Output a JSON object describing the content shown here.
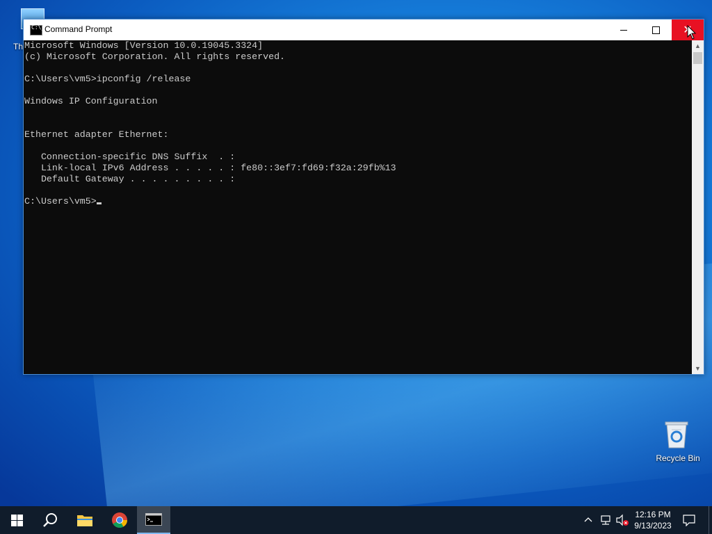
{
  "desktop": {
    "icons": [
      {
        "label": "Th"
      },
      {
        "label": "Recycle Bin"
      }
    ]
  },
  "window": {
    "title": "Command Prompt",
    "icon_glyph": "C:\\_",
    "controls": {
      "minimize": "minimize-icon",
      "maximize": "maximize-icon",
      "close": "close-icon"
    }
  },
  "console": {
    "lines": [
      "Microsoft Windows [Version 10.0.19045.3324]",
      "(c) Microsoft Corporation. All rights reserved.",
      "",
      "C:\\Users\\vm5>ipconfig /release",
      "",
      "Windows IP Configuration",
      "",
      "",
      "Ethernet adapter Ethernet:",
      "",
      "   Connection-specific DNS Suffix  . :",
      "   Link-local IPv6 Address . . . . . : fe80::3ef7:fd69:f32a:29fb%13",
      "   Default Gateway . . . . . . . . . :",
      ""
    ],
    "prompt": "C:\\Users\\vm5>"
  },
  "taskbar": {
    "items": [
      {
        "name": "start",
        "icon": "windows-logo-icon"
      },
      {
        "name": "search",
        "icon": "search-icon"
      },
      {
        "name": "file-explorer",
        "icon": "folder-icon"
      },
      {
        "name": "chrome",
        "icon": "chrome-icon"
      },
      {
        "name": "command-prompt",
        "icon": "cmd-icon",
        "active": true
      }
    ],
    "tray": {
      "time": "12:16 PM",
      "date": "9/13/2023"
    }
  },
  "colors": {
    "console_bg": "#0c0c0c",
    "console_fg": "#cccccc",
    "close_hover": "#e81123",
    "taskbar_bg": "#101c2b"
  }
}
